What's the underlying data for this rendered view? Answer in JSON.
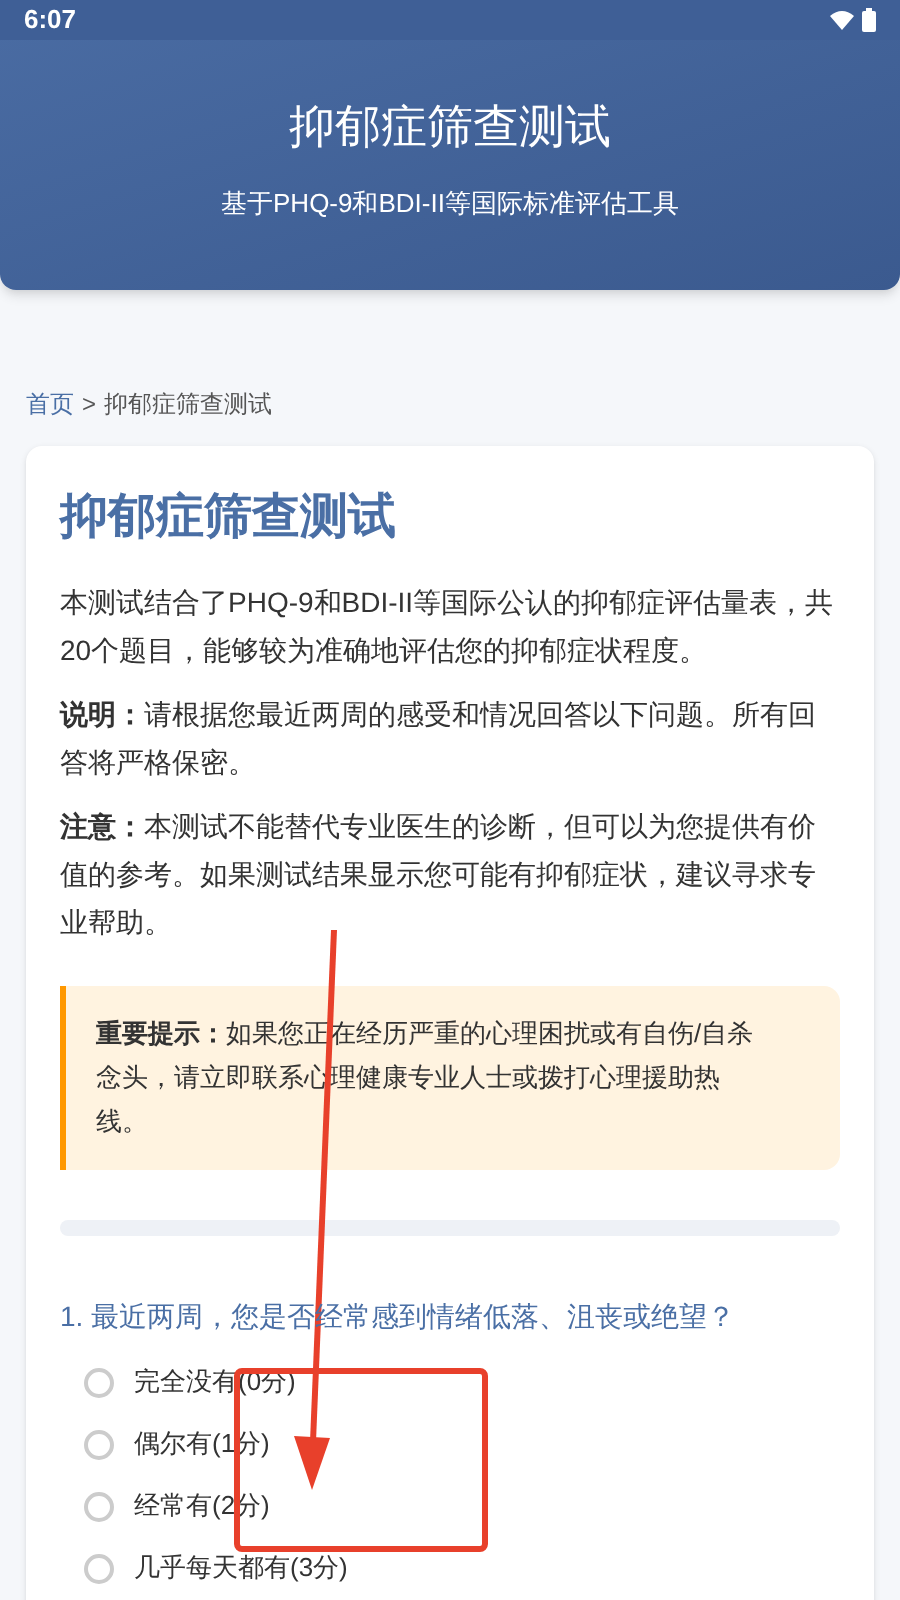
{
  "status_bar": {
    "time": "6:07"
  },
  "header": {
    "title": "抑郁症筛查测试",
    "subtitle": "基于PHQ-9和BDI-II等国际标准评估工具"
  },
  "breadcrumb": {
    "home": "首页",
    "separator": ">",
    "current": "抑郁症筛查测试"
  },
  "card": {
    "title": "抑郁症筛查测试",
    "paragraphs": [
      {
        "text": "本测试结合了PHQ-9和BDI-II等国际公认的抑郁症评估量表，共20个题目，能够较为准确地评估您的抑郁症状程度。"
      },
      {
        "label": "说明：",
        "text": "请根据您最近两周的感受和情况回答以下问题。所有回答将严格保密。"
      },
      {
        "label": "注意：",
        "text": "本测试不能替代专业医生的诊断，但可以为您提供有价值的参考。如果测试结果显示您可能有抑郁症状，建议寻求专业帮助。"
      }
    ],
    "notice": {
      "label": "重要提示：",
      "text": "如果您正在经历严重的心理困扰或有自伤/自杀念头，请立即联系心理健康专业人士或拨打心理援助热线。"
    },
    "question": {
      "text": "1. 最近两周，您是否经常感到情绪低落、沮丧或绝望？",
      "options": [
        {
          "label": "完全没有(0分)",
          "selected": false
        },
        {
          "label": "偶尔有(1分)",
          "selected": false
        },
        {
          "label": "经常有(2分)",
          "selected": false
        },
        {
          "label": "几乎每天都有(3分)",
          "selected": false
        }
      ]
    }
  }
}
